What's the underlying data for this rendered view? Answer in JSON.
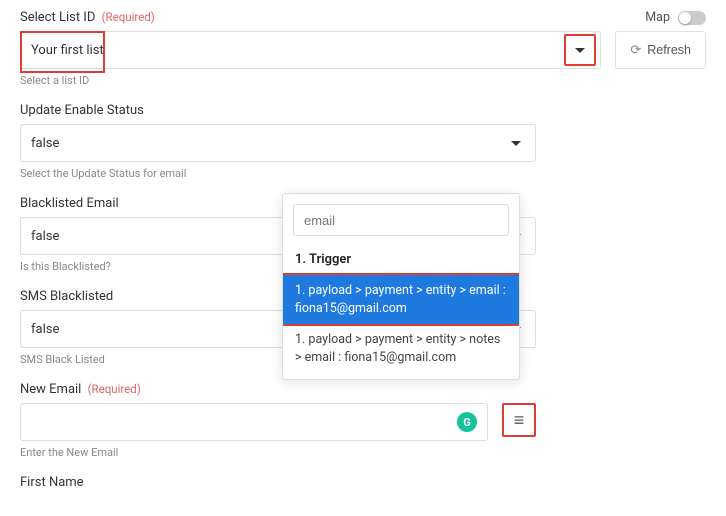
{
  "listId": {
    "label": "Select List ID",
    "required": "(Required)",
    "mapLabel": "Map",
    "value": "Your first list",
    "refresh": "Refresh",
    "helper": "Select a list ID"
  },
  "updateStatus": {
    "label": "Update Enable Status",
    "value": "false",
    "helper": "Select the Update Status for email"
  },
  "blacklistEmail": {
    "label": "Blacklisted Email",
    "value": "false",
    "helper": "Is this Blacklisted?"
  },
  "smsBlacklist": {
    "label": "SMS Blacklisted",
    "value": "false",
    "helper": "SMS Black Listed"
  },
  "newEmail": {
    "label": "New Email",
    "required": "(Required)",
    "value": "",
    "helper": "Enter the New Email"
  },
  "firstName": {
    "label": "First Name"
  },
  "popover": {
    "searchValue": "email",
    "header": "1. Trigger",
    "items": [
      {
        "text": "1. payload > payment > entity > email : fiona15@gmail.com",
        "selected": true
      },
      {
        "text": "1. payload > payment > entity > notes > email : fiona15@gmail.com",
        "selected": false
      }
    ]
  },
  "icons": {
    "gBadge": "G"
  }
}
